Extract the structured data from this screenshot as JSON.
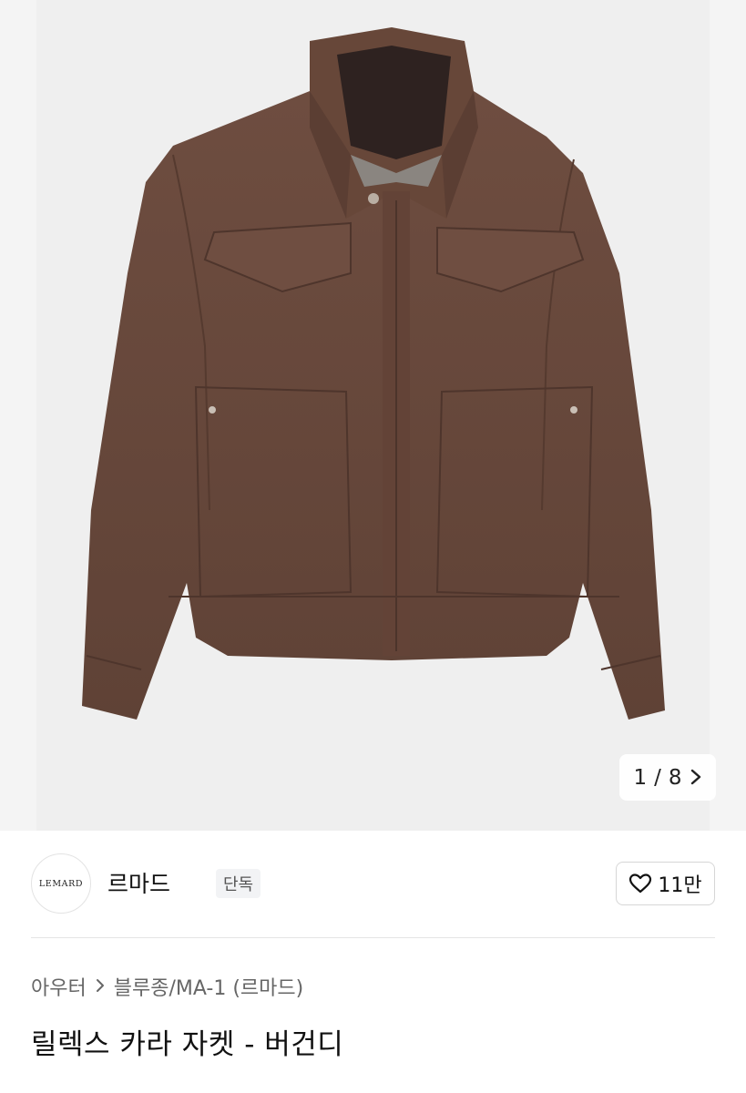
{
  "gallery": {
    "current": "1",
    "separator": "/",
    "total": "8",
    "next_icon": "chevron-right-icon"
  },
  "brand": {
    "logo_text": "LEMARD",
    "name": "르마드",
    "badge": "단독"
  },
  "like": {
    "icon": "heart-outline-icon",
    "count": "11만"
  },
  "breadcrumb": {
    "items": [
      "아우터",
      "블루종/MA-1 (르마드)"
    ],
    "separator_icon": "chevron-right-icon"
  },
  "product": {
    "title": "릴렉스 카라 자켓 - 버건디",
    "image_color": "#6b4a3d"
  }
}
